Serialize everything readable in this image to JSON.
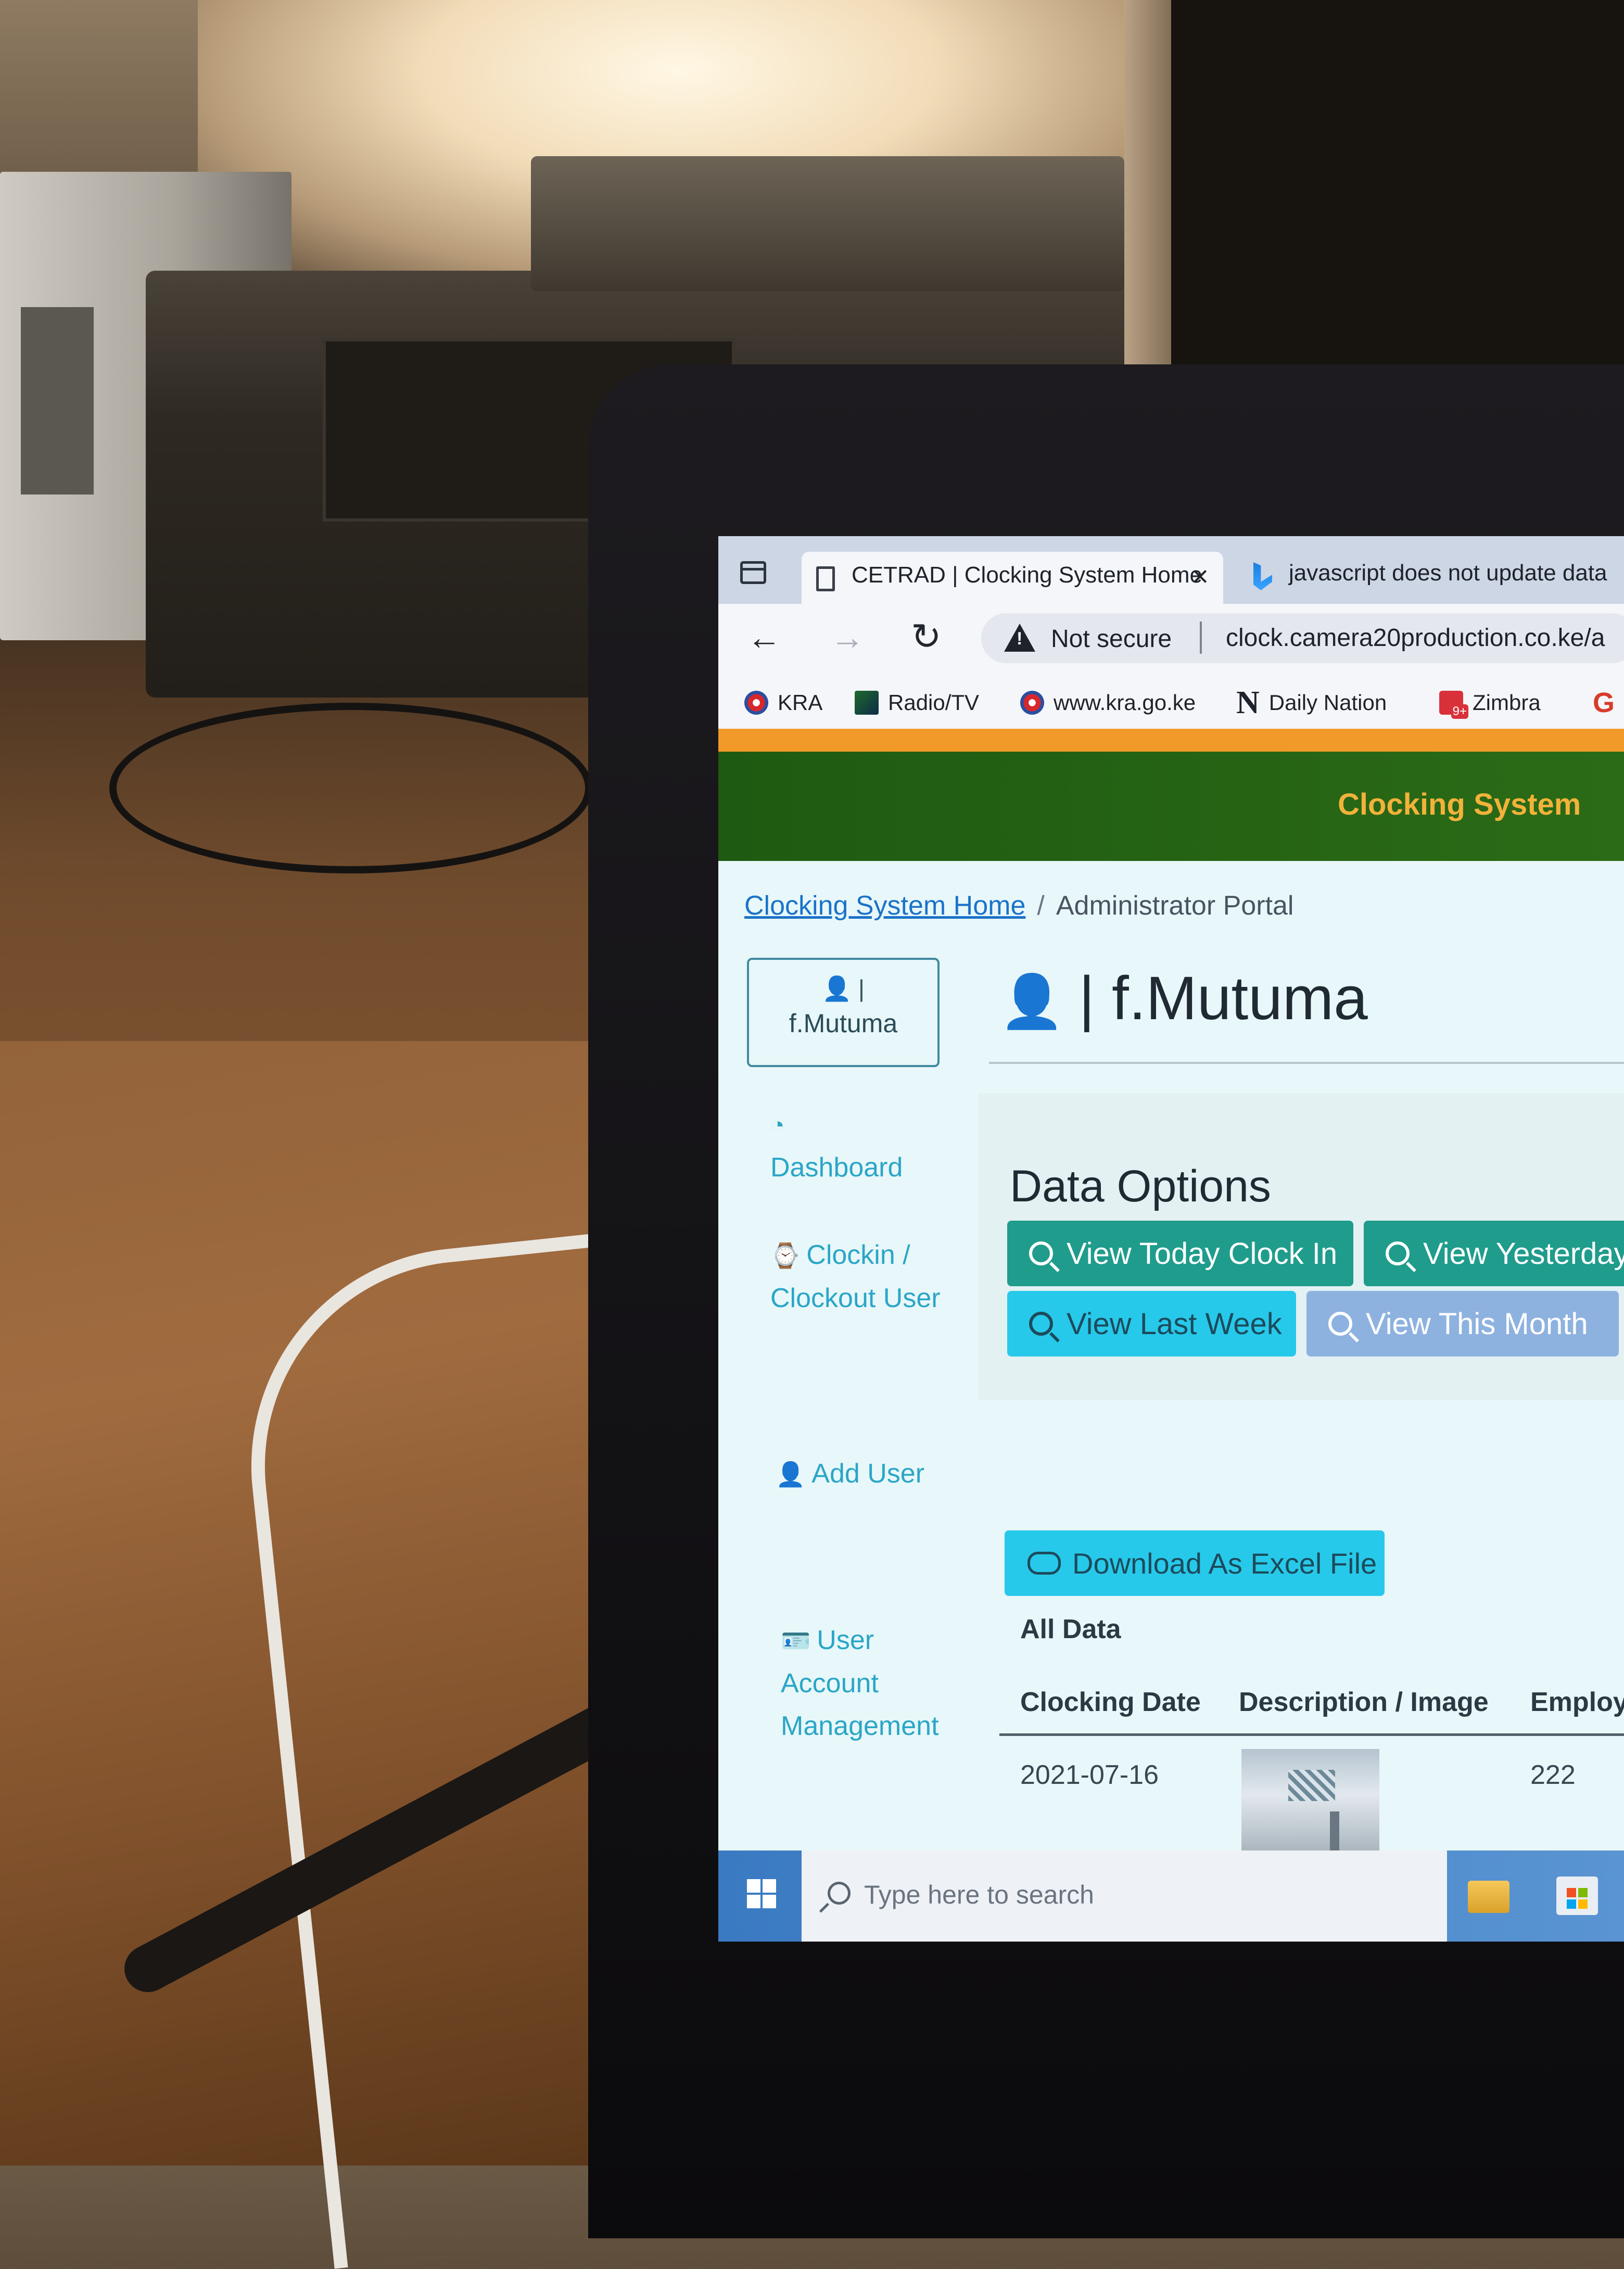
{
  "browser": {
    "active_tab_title": "CETRAD | Clocking System Home",
    "inactive_tab_title": "javascript does not update data",
    "security_label": "Not secure",
    "url": "clock.camera20production.co.ke/a"
  },
  "bookmarks": [
    {
      "label": "KRA",
      "icon": "kra-icon"
    },
    {
      "label": "Radio/TV",
      "icon": "radio-tv-icon"
    },
    {
      "label": "www.kra.go.ke",
      "icon": "kra-icon"
    },
    {
      "label": "Daily Nation",
      "icon": "n-icon"
    },
    {
      "label": "Zimbra",
      "icon": "zimbra-icon"
    },
    {
      "label": "G",
      "icon": "g-icon"
    }
  ],
  "site": {
    "title": "Clocking System",
    "colors": {
      "header_green": "#2b6b16",
      "accent_orange": "#f19a29",
      "title_gold": "#f2b23a"
    }
  },
  "breadcrumb": {
    "home": "Clocking System Home",
    "separator": "/",
    "current": "Administrator Portal"
  },
  "sidebar": {
    "user_icon_text": "|",
    "user_name": "f.Mutuma",
    "items": [
      {
        "label": "Dashboard",
        "icon": "dashboard-icon"
      },
      {
        "label": "Clockin / Clockout User",
        "icon": "watch-icon"
      },
      {
        "label": "Add User",
        "icon": "add-user-icon"
      },
      {
        "label": "User Account Management",
        "icon": "id-badge-icon"
      }
    ]
  },
  "main": {
    "profile_title": "| f.Mutuma",
    "data_options_heading": "Data Options",
    "buttons": {
      "today": "View Today Clock In",
      "yesterday": "View Yesterday",
      "last_week": "View Last Week",
      "this_month": "View This Month"
    },
    "download_label": "Download As Excel File",
    "all_data_label": "All Data",
    "table": {
      "headers": [
        "Clocking Date",
        "Description / Image",
        "Employ"
      ],
      "rows": [
        {
          "date": "2021-07-16",
          "image": "thumbnail",
          "employee": "222"
        }
      ]
    }
  },
  "taskbar": {
    "search_placeholder": "Type here to search"
  }
}
